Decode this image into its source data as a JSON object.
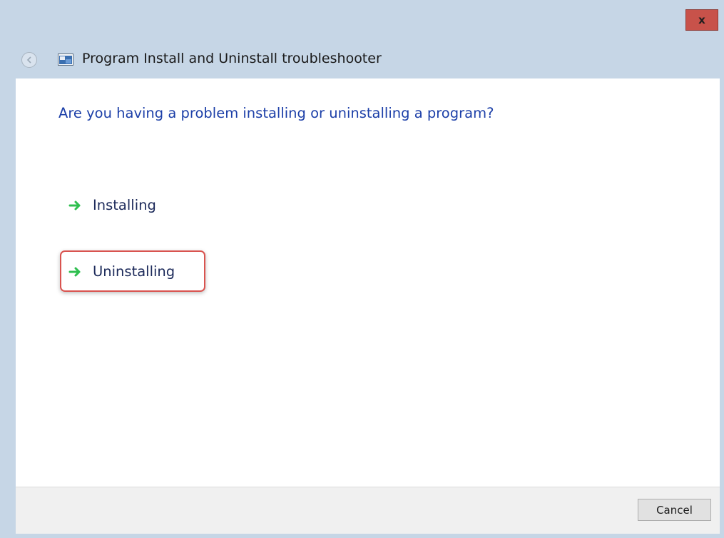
{
  "window": {
    "title": "Program Install and Uninstall troubleshooter",
    "close_label": "x",
    "back_icon": "back-arrow-icon",
    "app_icon": "troubleshooter-icon"
  },
  "main": {
    "question": "Are you having a problem installing or uninstalling a program?",
    "options": [
      {
        "label": "Installing",
        "icon": "green-arrow-icon"
      },
      {
        "label": "Uninstalling",
        "icon": "green-arrow-icon",
        "highlighted": true
      }
    ]
  },
  "footer": {
    "cancel_label": "Cancel"
  },
  "colors": {
    "frame": "#c6d6e6",
    "question_text": "#1c3fa8",
    "arrow_green": "#2fbf4f",
    "close_red": "#c8524a",
    "highlight_red": "#d9534f"
  }
}
